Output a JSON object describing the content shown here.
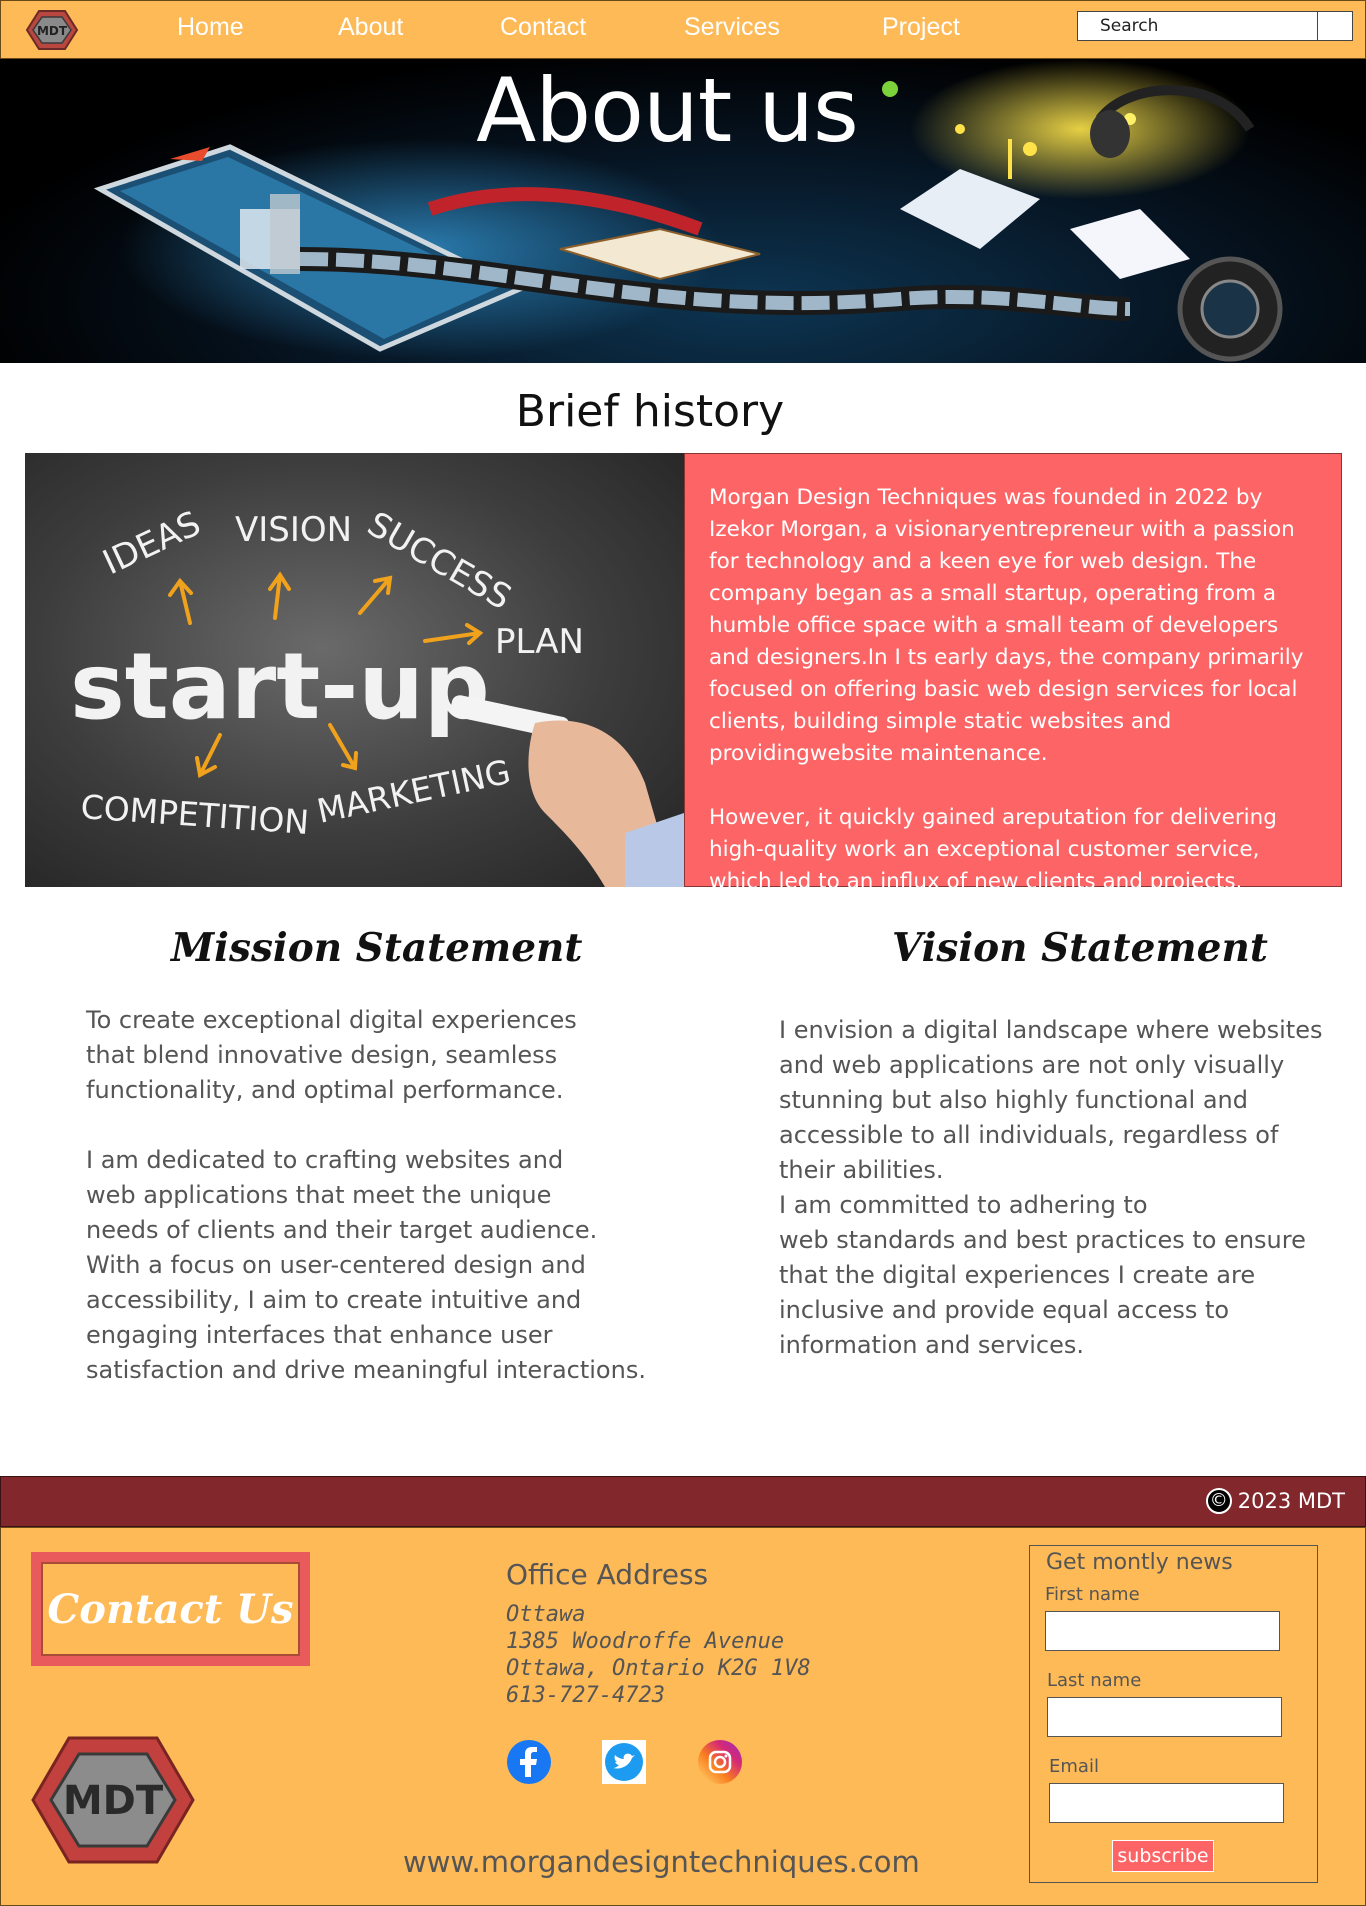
{
  "nav": {
    "logo_text": "MDT",
    "links": [
      "Home",
      "About",
      "Contact",
      "Services",
      "Project"
    ],
    "search_placeholder": "Search"
  },
  "hero": {
    "title": "About us"
  },
  "history": {
    "title": "Brief history",
    "image_words": {
      "ideas": "IDEAS",
      "vision": "VISION",
      "success": "SUCCESS",
      "plan": "PLAN",
      "main": "start-up",
      "competition": "COMPETITION",
      "marketing": "MARKETING"
    },
    "paragraph1": "Morgan Design Techniques was founded in 2022 by Izekor Morgan, a visionaryentrepreneur with a passion for technology and a keen eye for web design. The company began as a small startup, operating from a humble office space with a small team of developers and designers.In I ts early days, the company primarily focused on offering basic web design services for local clients, building simple static websites and providingwebsite maintenance.",
    "paragraph2": "However, it quickly gained areputation for delivering high-quality work an exceptional customer service, which led to an influx of new clients and projects."
  },
  "mission": {
    "title": "Mission Statement",
    "text": "To create exceptional digital experiences\nthat blend innovative design, seamless\nfunctionality, and optimal performance.\n\nI am dedicated to crafting websites and\nweb applications that meet the unique\nneeds of clients and their target audience.\nWith a focus on user-centered design and\naccessibility, I aim to create intuitive and\nengaging interfaces that enhance user\nsatisfaction and drive meaningful interactions."
  },
  "vision": {
    "title": "Vision Statement",
    "text": "I envision a digital landscape where websites\nand web applications are not only visually\nstunning but also highly functional and\naccessible to all individuals, regardless of\ntheir abilities.\nI am committed to adhering to\nweb standards and best practices to ensure\nthat the digital experiences I create are\ninclusive and provide equal access to\ninformation and services."
  },
  "copyright": {
    "symbol": "©",
    "text": "2023 MDT"
  },
  "footer": {
    "contact_label": "Contact Us",
    "logo_text": "MDT",
    "office_title": "Office Address",
    "address": [
      "Ottawa",
      "1385 Woodroffe Avenue",
      "Ottawa, Ontario K2G 1V8",
      "613-727-4723"
    ],
    "social_icons": [
      "facebook-icon",
      "twitter-icon",
      "instagram-icon"
    ],
    "url": "www.morgandesigntechniques.com",
    "newsletter": {
      "legend": "Get montly news",
      "first_name_label": "First name",
      "last_name_label": "Last name",
      "email_label": "Email",
      "subscribe_label": "subscribe"
    }
  },
  "colors": {
    "nav_bg": "#fdba57",
    "accent_red": "#fd6465",
    "copyright_bar": "#82282c",
    "text_gray": "#555555"
  }
}
